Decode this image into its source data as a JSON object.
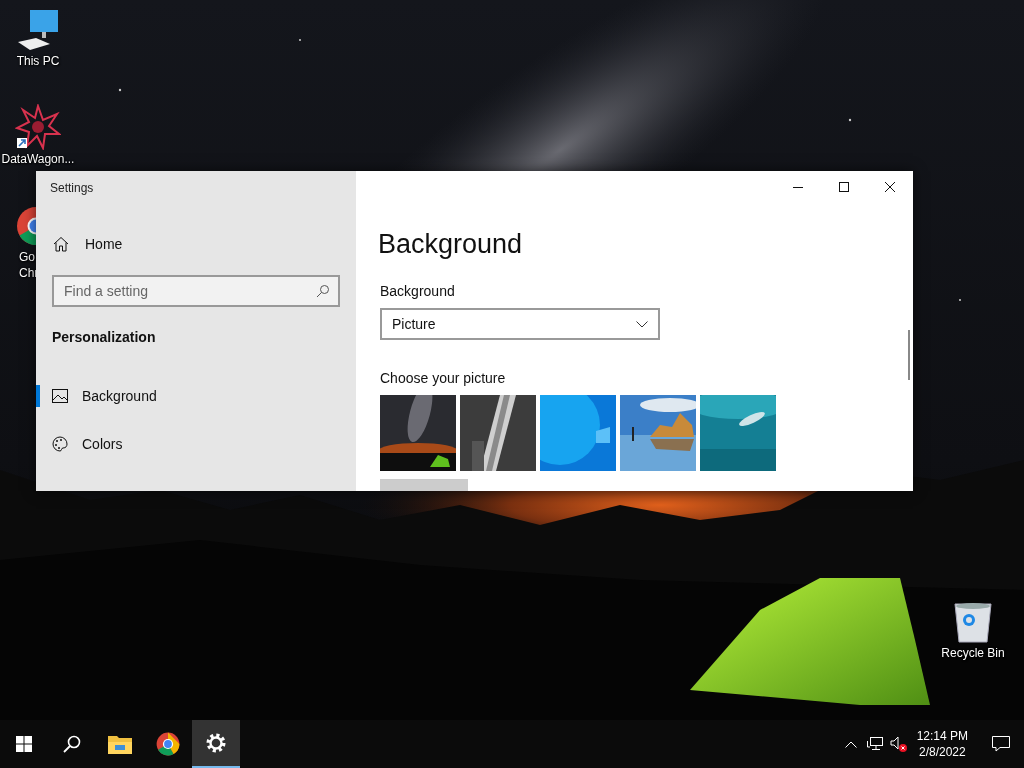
{
  "desktop": {
    "icons": [
      {
        "kind": "pc",
        "label_lines": [
          "This PC"
        ]
      },
      {
        "kind": "app",
        "label_lines": [
          "DataWagon..."
        ]
      },
      {
        "kind": "chrome",
        "label_lines": [
          "Go",
          "Chr"
        ]
      },
      {
        "kind": "recycle",
        "label_lines": [
          "Recycle Bin"
        ]
      }
    ]
  },
  "window": {
    "title": "Settings",
    "sidebar": {
      "home": "Home",
      "search": {
        "placeholder": "Find a setting"
      },
      "section": "Personalization",
      "items": [
        {
          "label": "Background",
          "selected": true
        },
        {
          "label": "Colors",
          "selected": false
        }
      ]
    },
    "page": {
      "title": "Background",
      "background_label": "Background",
      "background_value": "Picture",
      "choose_label": "Choose your picture"
    }
  },
  "taskbar": {
    "apps": [
      {
        "kind": "start",
        "active": false
      },
      {
        "kind": "search",
        "active": false
      },
      {
        "kind": "explorer",
        "active": false
      },
      {
        "kind": "chrome",
        "active": false
      },
      {
        "kind": "settings",
        "active": true
      }
    ],
    "tray": {
      "volume_muted": true,
      "time": "12:14 PM",
      "date": "2/8/2022"
    }
  }
}
